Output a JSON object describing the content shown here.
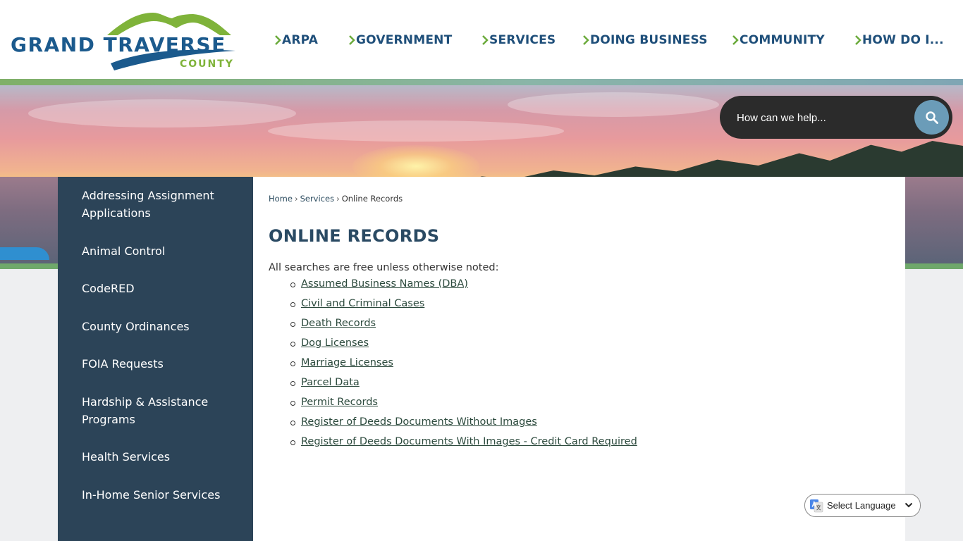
{
  "logo": {
    "name": "GRAND TRAVERSE",
    "sub": "COUNTY"
  },
  "nav": {
    "items": [
      {
        "label": "ARPA"
      },
      {
        "label": "GOVERNMENT"
      },
      {
        "label": "SERVICES"
      },
      {
        "label": "DOING BUSINESS"
      },
      {
        "label": "COMMUNITY"
      },
      {
        "label": "HOW DO I..."
      }
    ]
  },
  "search": {
    "placeholder": "How can we help..."
  },
  "sidebar": {
    "items": [
      {
        "label": "Addressing Assignment Applications"
      },
      {
        "label": "Animal Control"
      },
      {
        "label": "CodeRED"
      },
      {
        "label": "County Ordinances"
      },
      {
        "label": "FOIA Requests"
      },
      {
        "label": "Hardship & Assistance Programs"
      },
      {
        "label": "Health Services"
      },
      {
        "label": "In-Home Senior Services"
      }
    ]
  },
  "breadcrumb": {
    "home": "Home",
    "services": "Services",
    "current": "Online Records",
    "separator": "›"
  },
  "page": {
    "title": "ONLINE RECORDS",
    "intro": "All searches are free unless otherwise noted:",
    "links": [
      {
        "label": "Assumed Business Names (DBA)"
      },
      {
        "label": "Civil and Criminal Cases"
      },
      {
        "label": "Death Records"
      },
      {
        "label": "Dog Licenses"
      },
      {
        "label": "Marriage Licenses"
      },
      {
        "label": "Parcel Data"
      },
      {
        "label": "Permit Records"
      },
      {
        "label": "Register of Deeds Documents Without Images"
      },
      {
        "label": "Register of Deeds Documents With Images - Credit Card Required"
      }
    ]
  },
  "translate": {
    "label": "Select Language"
  },
  "colors": {
    "brand_blue": "#1b5a8d",
    "brand_green": "#7fb33a",
    "sidebar_bg": "#2c4458",
    "title_color": "#2a4a63",
    "search_button": "#6b9cb8"
  },
  "icons": {
    "search": "search-icon",
    "nav_chevron": "chevron-right-icon",
    "translate": "google-translate-icon",
    "dropdown": "chevron-down-icon"
  }
}
